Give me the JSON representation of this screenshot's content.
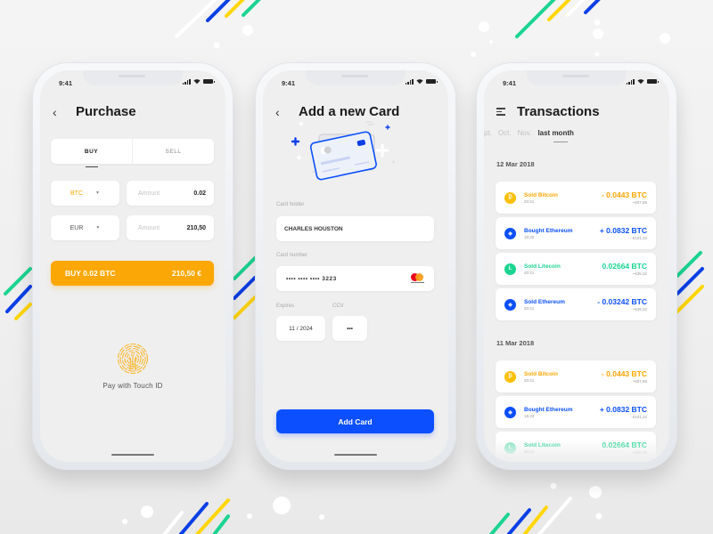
{
  "colors": {
    "bitcoin": "#fba705",
    "ethereum": "#0b4fff",
    "litecoin": "#1bd491",
    "purchase_button": "#fba705",
    "add_card_button": "#0b4fff",
    "yellow_stripe": "#ffd60a"
  },
  "status_bar": {
    "time": "9:41"
  },
  "purchase": {
    "title": "Purchase",
    "back_icon": "chevron-left-icon",
    "tabs": [
      {
        "label": "BUY",
        "active": true
      },
      {
        "label": "SELL",
        "active": false
      }
    ],
    "rows": [
      {
        "currency": "BTC",
        "amount_placeholder": "Amount",
        "amount": "0.02"
      },
      {
        "currency": "EUR",
        "amount_placeholder": "Amount",
        "amount": "210,50"
      }
    ],
    "buy_button": {
      "label": "BUY 0.02 BTC",
      "total": "210,50 €"
    },
    "touch_id": {
      "icon": "fingerprint-icon",
      "label": "Pay with Touch ID"
    }
  },
  "add_card": {
    "title": "Add a new Card",
    "illustration": "credit-card-icon",
    "card_holder_label": "Card holder",
    "card_holder_value": "CHARLES HOUSTON",
    "card_number_label": "Card number",
    "card_number_value": "••••  ••••  ••••  3223",
    "card_brand": "mastercard-icon",
    "expires_label": "Expires",
    "expires_value": "11 / 2024",
    "ccv_label": "CCV",
    "ccv_value": "•••",
    "button_label": "Add Card"
  },
  "transactions": {
    "title": "Transactions",
    "menu_icon": "menu-icon",
    "months": [
      {
        "label": "pt.",
        "active": false
      },
      {
        "label": "Oct.",
        "active": false
      },
      {
        "label": "Nov.",
        "active": false
      },
      {
        "label": "last month",
        "active": true
      }
    ],
    "groups": [
      {
        "date": "12 Mar 2018",
        "items": [
          {
            "coin": "bitcoin",
            "glyph": "₿",
            "name": "Sold Bitcoin",
            "time": "20:21",
            "amount": "- 0.0443 BTC",
            "eur": "+€57,85"
          },
          {
            "coin": "ethereum",
            "glyph": "◆",
            "name": "Bought Ethereum",
            "time": "18:33",
            "amount": "+ 0.0832 BTC",
            "eur": "- €101,22"
          },
          {
            "coin": "litecoin",
            "glyph": "Ł",
            "name": "Sold Litecoin",
            "time": "20:21",
            "amount": "0.02664 BTC",
            "eur": "+€35,32"
          },
          {
            "coin": "ethereum",
            "glyph": "◆",
            "name": "Sold Ethereum",
            "time": "20:21",
            "amount": "- 0.03242 BTC",
            "eur": "+€48,22"
          }
        ]
      },
      {
        "date": "11 Mar 2018",
        "items": [
          {
            "coin": "bitcoin",
            "glyph": "₿",
            "name": "Sold Bitcoin",
            "time": "20:21",
            "amount": "- 0.0443 BTC",
            "eur": "+€57,85"
          },
          {
            "coin": "ethereum",
            "glyph": "◆",
            "name": "Bought Ethereum",
            "time": "18:33",
            "amount": "+ 0.0832 BTC",
            "eur": "- €101,22"
          },
          {
            "coin": "litecoin",
            "glyph": "Ł",
            "name": "Sold Litecoin",
            "time": "20:21",
            "amount": "0.02664 BTC",
            "eur": "+€35,32"
          }
        ]
      }
    ]
  }
}
